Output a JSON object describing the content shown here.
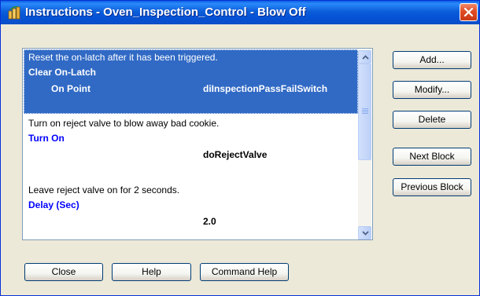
{
  "window": {
    "title": "Instructions - Oven_Inspection_Control - Blow Off",
    "icon": "app-icon",
    "close_icon": "close-icon"
  },
  "instructions": {
    "items": [
      {
        "comment": "Reset the on-latch after it has been triggered.",
        "command": "Clear On-Latch",
        "param_label": "On Point",
        "param_value": "diInspectionPassFailSwitch",
        "selected": true
      },
      {
        "comment": "Turn on reject valve to blow away bad cookie.",
        "command": "Turn On",
        "param_label": "",
        "param_value": "doRejectValve",
        "selected": false
      },
      {
        "comment": "Leave reject valve on for 2 seconds.",
        "command": "Delay (Sec)",
        "param_label": "",
        "param_value": "2.0",
        "selected": false
      }
    ]
  },
  "side_buttons": {
    "add": "Add...",
    "modify": "Modify...",
    "delete": "Delete",
    "next_block": "Next Block",
    "previous_block": "Previous Block"
  },
  "bottom_buttons": {
    "close": "Close",
    "help": "Help",
    "command_help": "Command Help"
  },
  "colors": {
    "selection": "#316ac5",
    "command_text": "#0000ff",
    "title_bar": "#0a5fe0"
  }
}
